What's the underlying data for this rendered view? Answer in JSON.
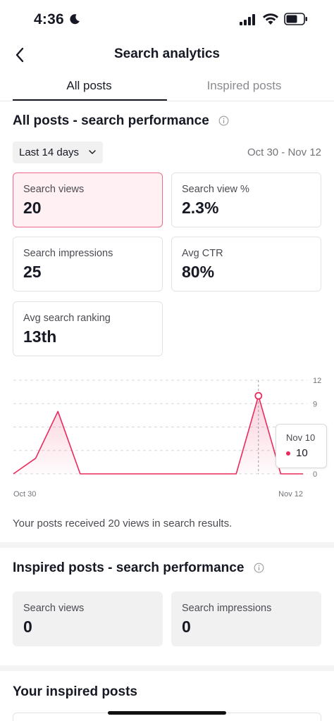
{
  "status_bar": {
    "time": "4:36"
  },
  "nav": {
    "title": "Search analytics"
  },
  "tabs": [
    {
      "label": "All posts"
    },
    {
      "label": "Inspired posts"
    }
  ],
  "all_posts": {
    "title": "All posts - search performance",
    "range_label": "Last 14 days",
    "date_range": "Oct 30 - Nov 12",
    "metrics": [
      {
        "label": "Search views",
        "value": "20"
      },
      {
        "label": "Search view %",
        "value": "2.3%"
      },
      {
        "label": "Search impressions",
        "value": "25"
      },
      {
        "label": "Avg CTR",
        "value": "80%"
      },
      {
        "label": "Avg search ranking",
        "value": "13th"
      }
    ],
    "chart_note": "Your posts received 20 views in search results."
  },
  "chart_data": {
    "type": "area",
    "x_start_label": "Oct 30",
    "x_end_label": "Nov 12",
    "y_ticks": [
      "12",
      "9",
      "0"
    ],
    "ylim": [
      0,
      12
    ],
    "series": [
      {
        "values": [
          0,
          2,
          8,
          0,
          0,
          0,
          0,
          0,
          0,
          0,
          0,
          10,
          0,
          0
        ]
      }
    ],
    "accent_color": "#ea2a5c",
    "grid": true,
    "tooltip": {
      "date": "Nov 10",
      "value": "10"
    }
  },
  "inspired": {
    "title": "Inspired posts - search performance",
    "metrics": [
      {
        "label": "Search views",
        "value": "0"
      },
      {
        "label": "Search impressions",
        "value": "0"
      }
    ]
  },
  "your_inspired": {
    "title": "Your inspired posts"
  }
}
